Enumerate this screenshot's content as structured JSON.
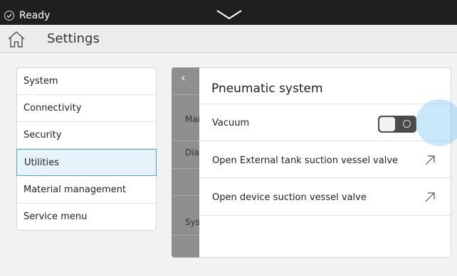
{
  "status_bar": {
    "status_text": "Ready",
    "status_icon": "check-circle-icon",
    "expand_icon": "chevron-down-icon"
  },
  "header": {
    "home_icon": "home-icon",
    "title": "Settings"
  },
  "menu": {
    "items": [
      {
        "label": "System",
        "active": false
      },
      {
        "label": "Connectivity",
        "active": false
      },
      {
        "label": "Security",
        "active": false
      },
      {
        "label": "Utilities",
        "active": true
      },
      {
        "label": "Material management",
        "active": false
      },
      {
        "label": "Service menu",
        "active": false
      }
    ]
  },
  "behind_panel": {
    "back_icon": "chevron-left-icon",
    "labels": [
      "Mai",
      "Dia",
      "Sys"
    ]
  },
  "panel": {
    "title": "Pneumatic system",
    "rows": [
      {
        "label": "Vacuum",
        "control": "toggle",
        "toggle_on": false
      },
      {
        "label": "Open External tank suction vessel valve",
        "icon": "external-link-icon"
      },
      {
        "label": "Open device suction vessel valve",
        "icon": "external-link-icon"
      }
    ]
  },
  "colors": {
    "accent": "#4aa7d8",
    "active_bg": "#e6f3fb",
    "status_bar": "#1f1f1f"
  }
}
